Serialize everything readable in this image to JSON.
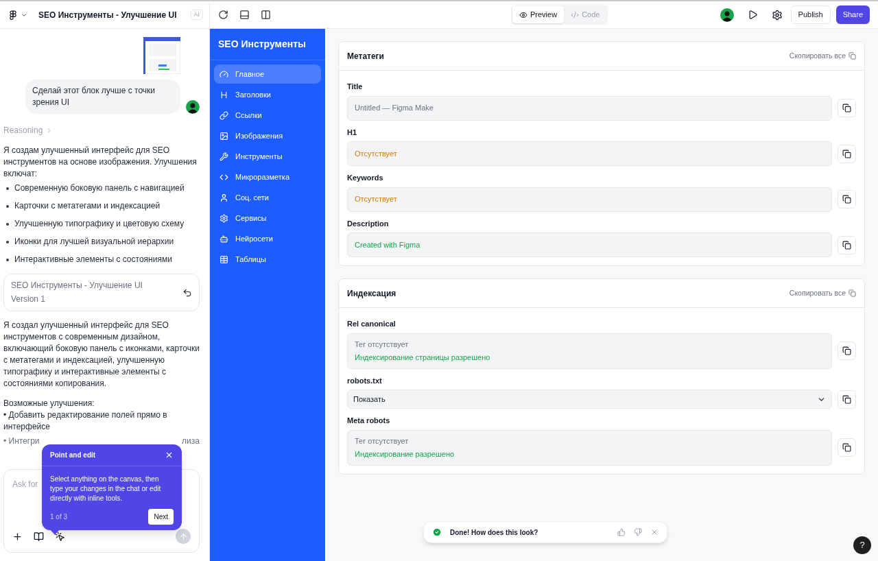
{
  "topbar": {
    "project_title": "SEO Инструменты - Улучшение UI",
    "ai_badge": "AI",
    "view_tabs": [
      {
        "label": "Preview",
        "selected": true
      },
      {
        "label": "Code",
        "selected": false
      }
    ],
    "publish": "Publish",
    "share": "Share"
  },
  "chat": {
    "user_message": "Сделай этот блок лучше с точки зрения UI",
    "reasoning": "Reasoning",
    "intro": "Я создам улучшенный интерфейс для SEO инструментов на основе изображения. Улучшения включат:",
    "bullets": [
      "Современную боковую панель с навигацией",
      "Карточки с метатегами и индексацией",
      "Улучшенную типографику и цветовую схему",
      "Иконки для лучшей визуальной иерархии",
      "Интерактивные элементы с состояниями"
    ],
    "version_card": {
      "title": "SEO Инструменты - Улучшение UI",
      "version": "Version 1"
    },
    "summary": "Я создал улучшенный интерфейс для SEO инструментов с современным дизайном, включающий боковую панель с иконками, карточки с метатегами и индексацией, улучшенную типографику и интерактивные элементы с состояниями копирования.",
    "improvements_heading": "Возможные улучшения:",
    "improvement_1": "• Добавить редактирование полей прямо в интерфейсе",
    "improvement_2_left": "• Интегри",
    "improvement_2_right": "лиза",
    "input_placeholder": "Ask for"
  },
  "tour_popover": {
    "title": "Point and edit",
    "body": "Select anything on the canvas, then type your changes in the chat or edit directly with inline tools.",
    "step": "1 of 3",
    "next": "Next"
  },
  "app": {
    "brand": "SEO Инструменты",
    "nav": [
      {
        "label": "Главное",
        "selected": true
      },
      {
        "label": "Заголовки",
        "selected": false
      },
      {
        "label": "Ссылки",
        "selected": false
      },
      {
        "label": "Изображения",
        "selected": false
      },
      {
        "label": "Инструменты",
        "selected": false
      },
      {
        "label": "Микроразметка",
        "selected": false
      },
      {
        "label": "Соц. сети",
        "selected": false
      },
      {
        "label": "Сервисы",
        "selected": false
      },
      {
        "label": "Нейросети",
        "selected": false
      },
      {
        "label": "Таблицы",
        "selected": false
      }
    ],
    "cards": [
      {
        "title": "Метатеги",
        "copy_all": "Скопировать все",
        "fields": [
          {
            "label": "Title",
            "kind": "text",
            "lines": [
              {
                "text": "Untitled — Figma Make",
                "color": "#6b7280"
              }
            ]
          },
          {
            "label": "H1",
            "kind": "text",
            "lines": [
              {
                "text": "Отсутствует",
                "color": "#d97706"
              }
            ]
          },
          {
            "label": "Keywords",
            "kind": "text",
            "lines": [
              {
                "text": "Отсутствует",
                "color": "#d97706"
              }
            ]
          },
          {
            "label": "Description",
            "kind": "text",
            "lines": [
              {
                "text": "Created with Figma",
                "color": "#16a34a"
              }
            ]
          }
        ]
      },
      {
        "title": "Индексация",
        "copy_all": "Скопировать все",
        "fields": [
          {
            "label": "Rel canonical",
            "kind": "text",
            "lines": [
              {
                "text": "Тег отсутствует",
                "color": "#6b7280"
              },
              {
                "text": "Индексирование страницы разрешено",
                "color": "#16a34a"
              }
            ]
          },
          {
            "label": "robots.txt",
            "kind": "select",
            "lines": [
              {
                "text": "Показать",
                "color": "#111827"
              }
            ]
          },
          {
            "label": "Meta robots",
            "kind": "text",
            "lines": [
              {
                "text": "Тег отсутствует",
                "color": "#6b7280"
              },
              {
                "text": "Индексирование разрешено",
                "color": "#16a34a"
              }
            ]
          }
        ]
      }
    ]
  },
  "toast": {
    "message": "Done! How does this look?"
  },
  "help": "?"
}
